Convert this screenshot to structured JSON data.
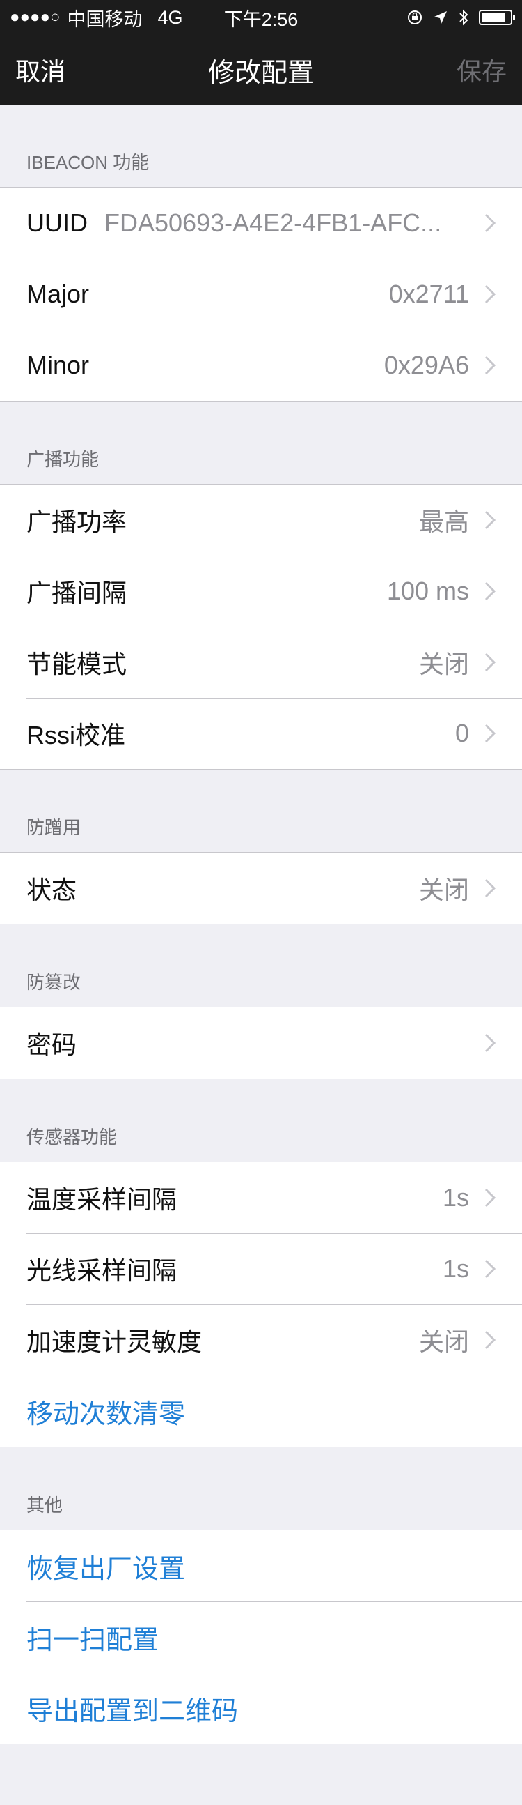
{
  "status_bar": {
    "signal": "●●●●○",
    "carrier": "中国移动",
    "network": "4G",
    "time": "下午2:56",
    "battery_level": 0.85
  },
  "nav": {
    "cancel": "取消",
    "title": "修改配置",
    "save": "保存"
  },
  "sections": {
    "ibeacon": {
      "header": "IBEACON 功能",
      "uuid": {
        "label": "UUID",
        "value": "FDA50693-A4E2-4FB1-AFC..."
      },
      "major": {
        "label": "Major",
        "value": "0x2711"
      },
      "minor": {
        "label": "Minor",
        "value": "0x29A6"
      }
    },
    "broadcast": {
      "header": "广播功能",
      "power": {
        "label": "广播功率",
        "value": "最高"
      },
      "interval": {
        "label": "广播间隔",
        "value": "100 ms"
      },
      "energy": {
        "label": "节能模式",
        "value": "关闭"
      },
      "rssi": {
        "label": "Rssi校准",
        "value": "0"
      }
    },
    "anti_hijack": {
      "header": "防蹭用",
      "state": {
        "label": "状态",
        "value": "关闭"
      }
    },
    "anti_tamper": {
      "header": "防篡改",
      "password": {
        "label": "密码"
      }
    },
    "sensor": {
      "header": "传感器功能",
      "temp_interval": {
        "label": "温度采样间隔",
        "value": "1s"
      },
      "light_interval": {
        "label": "光线采样间隔",
        "value": "1s"
      },
      "accel": {
        "label": "加速度计灵敏度",
        "value": "关闭"
      },
      "reset_moves": "移动次数清零"
    },
    "other": {
      "header": "其他",
      "factory_reset": "恢复出厂设置",
      "scan_config": "扫一扫配置",
      "export_qr": "导出配置到二维码"
    }
  }
}
